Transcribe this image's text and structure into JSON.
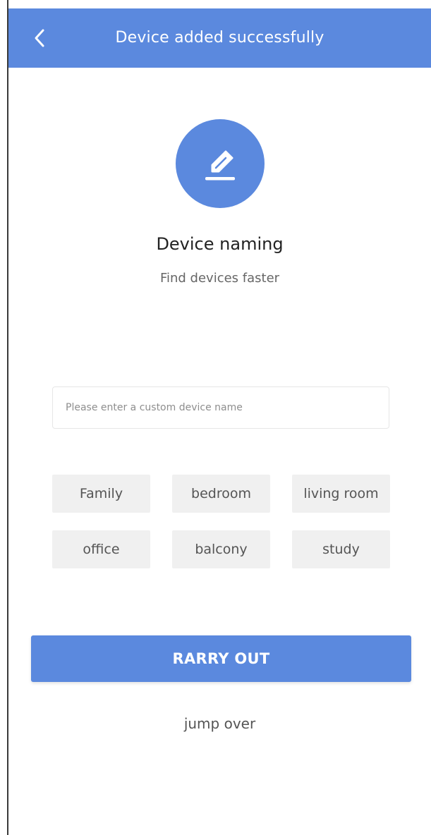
{
  "header": {
    "title": "Device added successfully",
    "back_icon": "chevron-left-icon"
  },
  "badge": {
    "icon": "edit-pencil-icon",
    "color": "#5b89de"
  },
  "naming": {
    "title": "Device naming",
    "subtitle": "Find devices faster"
  },
  "input": {
    "value": "",
    "placeholder": "Please enter a custom device name"
  },
  "tags": [
    "Family",
    "bedroom",
    "living room",
    "office",
    "balcony",
    "study"
  ],
  "actions": {
    "confirm_label": "RARRY OUT",
    "skip_label": "jump over"
  },
  "colors": {
    "accent": "#5b89de",
    "tag_background": "#f0f0f0",
    "text_primary": "#222222",
    "text_secondary": "#666666"
  }
}
